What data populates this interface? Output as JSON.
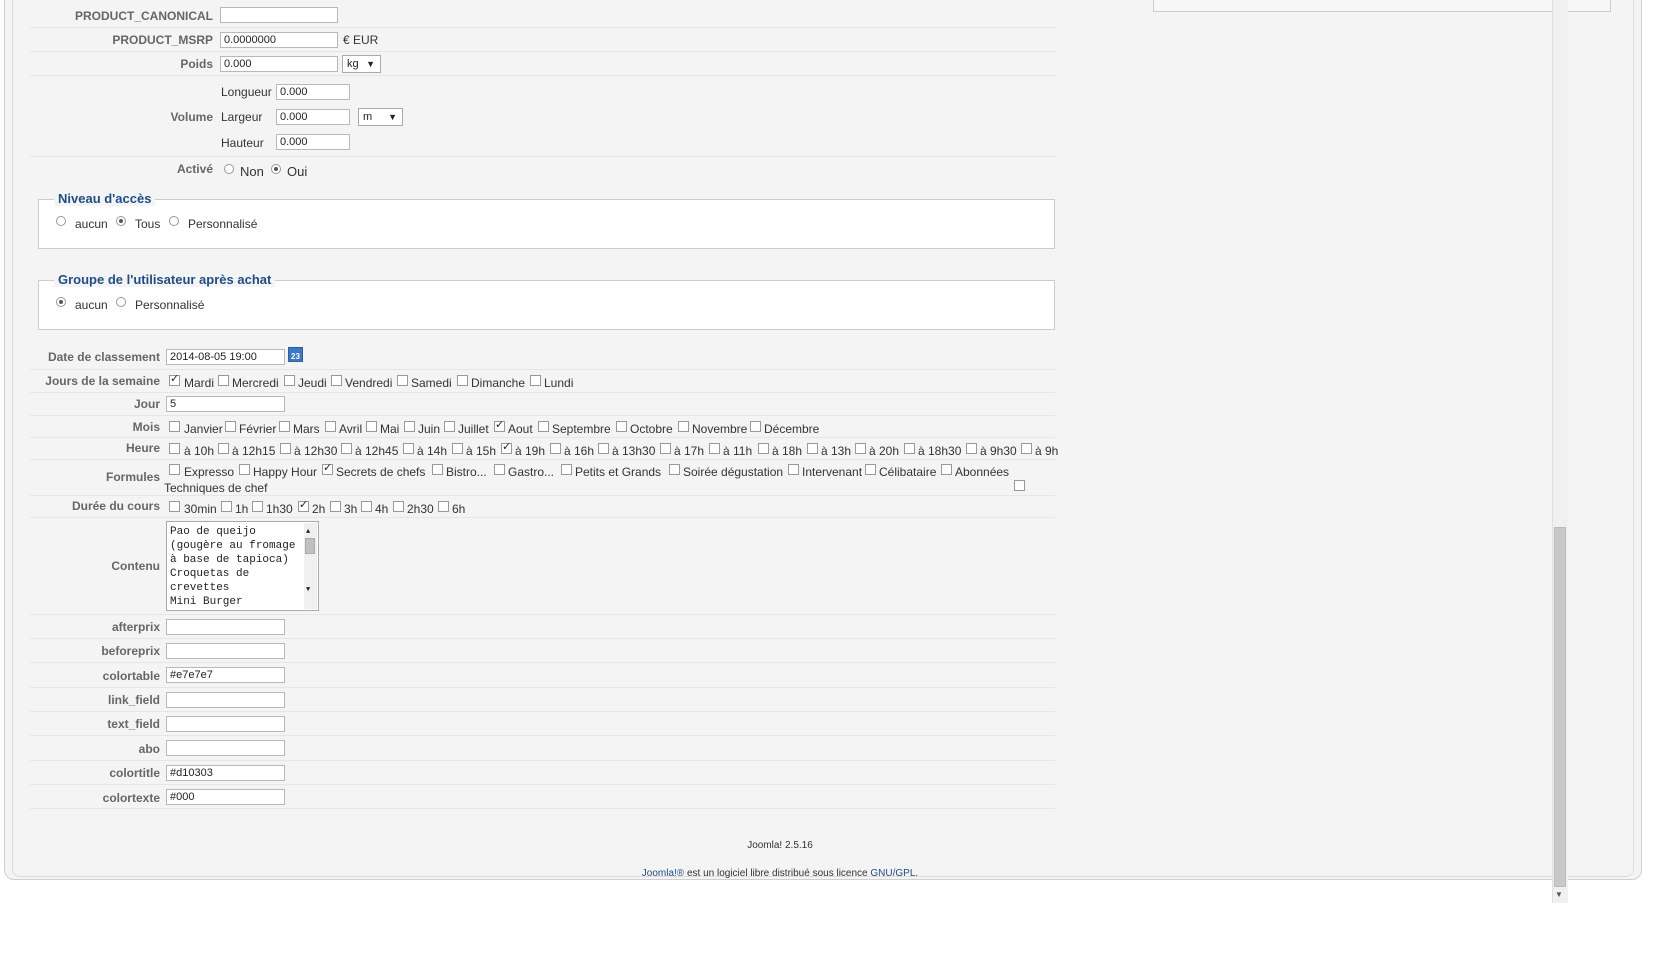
{
  "product": {
    "canonical_label": "PRODUCT_CANONICAL",
    "canonical_value": "",
    "msrp_label": "PRODUCT_MSRP",
    "msrp_value": "0.0000000",
    "msrp_currency": "€ EUR",
    "weight_label": "Poids",
    "weight_value": "0.000",
    "weight_unit": "kg",
    "volume_label": "Volume",
    "length_label": "Longueur",
    "length_value": "0.000",
    "width_label": "Largeur",
    "width_value": "0.000",
    "height_label": "Hauteur",
    "height_value": "0.000",
    "volume_unit": "m",
    "active_label": "Activé",
    "active_options": [
      "Non",
      "Oui"
    ],
    "active_selected": "Oui"
  },
  "access": {
    "legend": "Niveau d'accès",
    "options": [
      "aucun",
      "Tous",
      "Personnalisé"
    ],
    "selected": "Tous"
  },
  "group": {
    "legend": "Groupe de l'utilisateur après achat",
    "options": [
      "aucun",
      "Personnalisé"
    ],
    "selected": "aucun"
  },
  "fields": {
    "date_label": "Date de classement",
    "date_value": "2014-08-05 19:00",
    "calendar_icon_text": "23",
    "weekdays_label": "Jours de la semaine",
    "weekdays": [
      {
        "label": "Mardi",
        "checked": true
      },
      {
        "label": "Mercredi",
        "checked": false
      },
      {
        "label": "Jeudi",
        "checked": false
      },
      {
        "label": "Vendredi",
        "checked": false
      },
      {
        "label": "Samedi",
        "checked": false
      },
      {
        "label": "Dimanche",
        "checked": false
      },
      {
        "label": "Lundi",
        "checked": false
      }
    ],
    "day_label": "Jour",
    "day_value": "5",
    "months_label": "Mois",
    "months": [
      {
        "label": "Janvier",
        "checked": false
      },
      {
        "label": "Février",
        "checked": false
      },
      {
        "label": "Mars",
        "checked": false
      },
      {
        "label": "Avril",
        "checked": false
      },
      {
        "label": "Mai",
        "checked": false
      },
      {
        "label": "Juin",
        "checked": false
      },
      {
        "label": "Juillet",
        "checked": false
      },
      {
        "label": "Aout",
        "checked": true
      },
      {
        "label": "Septembre",
        "checked": false
      },
      {
        "label": "Octobre",
        "checked": false
      },
      {
        "label": "Novembre",
        "checked": false
      },
      {
        "label": "Décembre",
        "checked": false
      }
    ],
    "hours_label": "Heure",
    "hours": [
      {
        "label": "à 10h",
        "checked": false
      },
      {
        "label": "à 12h15",
        "checked": false
      },
      {
        "label": "à 12h30",
        "checked": false
      },
      {
        "label": "à 12h45",
        "checked": false
      },
      {
        "label": "à 14h",
        "checked": false
      },
      {
        "label": "à 15h",
        "checked": false
      },
      {
        "label": "à 19h",
        "checked": true
      },
      {
        "label": "à 16h",
        "checked": false
      },
      {
        "label": "à 13h30",
        "checked": false
      },
      {
        "label": "à 17h",
        "checked": false
      },
      {
        "label": "à 11h",
        "checked": false
      },
      {
        "label": "à 18h",
        "checked": false
      },
      {
        "label": "à 13h",
        "checked": false
      },
      {
        "label": "à 20h",
        "checked": false
      },
      {
        "label": "à 18h30",
        "checked": false
      },
      {
        "label": "à 9h30",
        "checked": false
      },
      {
        "label": "à 9h",
        "checked": false
      }
    ],
    "formulas_label": "Formules",
    "formulas": [
      {
        "label": "Expresso",
        "checked": false
      },
      {
        "label": "Happy Hour",
        "checked": false
      },
      {
        "label": "Secrets de chefs",
        "checked": true
      },
      {
        "label": "Bistro...",
        "checked": false
      },
      {
        "label": "Gastro...",
        "checked": false
      },
      {
        "label": "Petits et Grands",
        "checked": false
      },
      {
        "label": "Soirée dégustation",
        "checked": false
      },
      {
        "label": "Intervenant",
        "checked": false
      },
      {
        "label": "Célibataire",
        "checked": false
      },
      {
        "label": "Abonnées",
        "checked": false
      },
      {
        "label": "Techniques de chef",
        "checked": false
      }
    ],
    "duration_label": "Durée du cours",
    "durations": [
      {
        "label": "30min",
        "checked": false
      },
      {
        "label": "1h",
        "checked": false
      },
      {
        "label": "1h30",
        "checked": false
      },
      {
        "label": "2h",
        "checked": true
      },
      {
        "label": "3h",
        "checked": false
      },
      {
        "label": "4h",
        "checked": false
      },
      {
        "label": "2h30",
        "checked": false
      },
      {
        "label": "6h",
        "checked": false
      }
    ],
    "content_label": "Contenu",
    "content_value": "Pao de queijo\n(gougère au fromage\nà base de tapioca)\nCroquetas de\ncrevettes\nMini Burger",
    "afterprix_label": "afterprix",
    "afterprix_value": "",
    "beforeprix_label": "beforeprix",
    "beforeprix_value": "",
    "colortable_label": "colortable",
    "colortable_value": "#e7e7e7",
    "link_field_label": "link_field",
    "link_field_value": "",
    "text_field_label": "text_field",
    "text_field_value": "",
    "abo_label": "abo",
    "abo_value": "",
    "colortitle_label": "colortitle",
    "colortitle_value": "#d10303",
    "colortexte_label": "colortexte",
    "colortexte_value": "#000"
  },
  "footer": {
    "version": "Joomla! 2.5.16",
    "joomla_link": "Joomla!®",
    "license_text": " est un logiciel libre distribué sous licence ",
    "gpl_link": "GNU/GPL",
    "period": "."
  },
  "colors": {
    "legend": "#1e4d8c",
    "link": "#1e4d8c",
    "calendar": "#3a78c9"
  }
}
